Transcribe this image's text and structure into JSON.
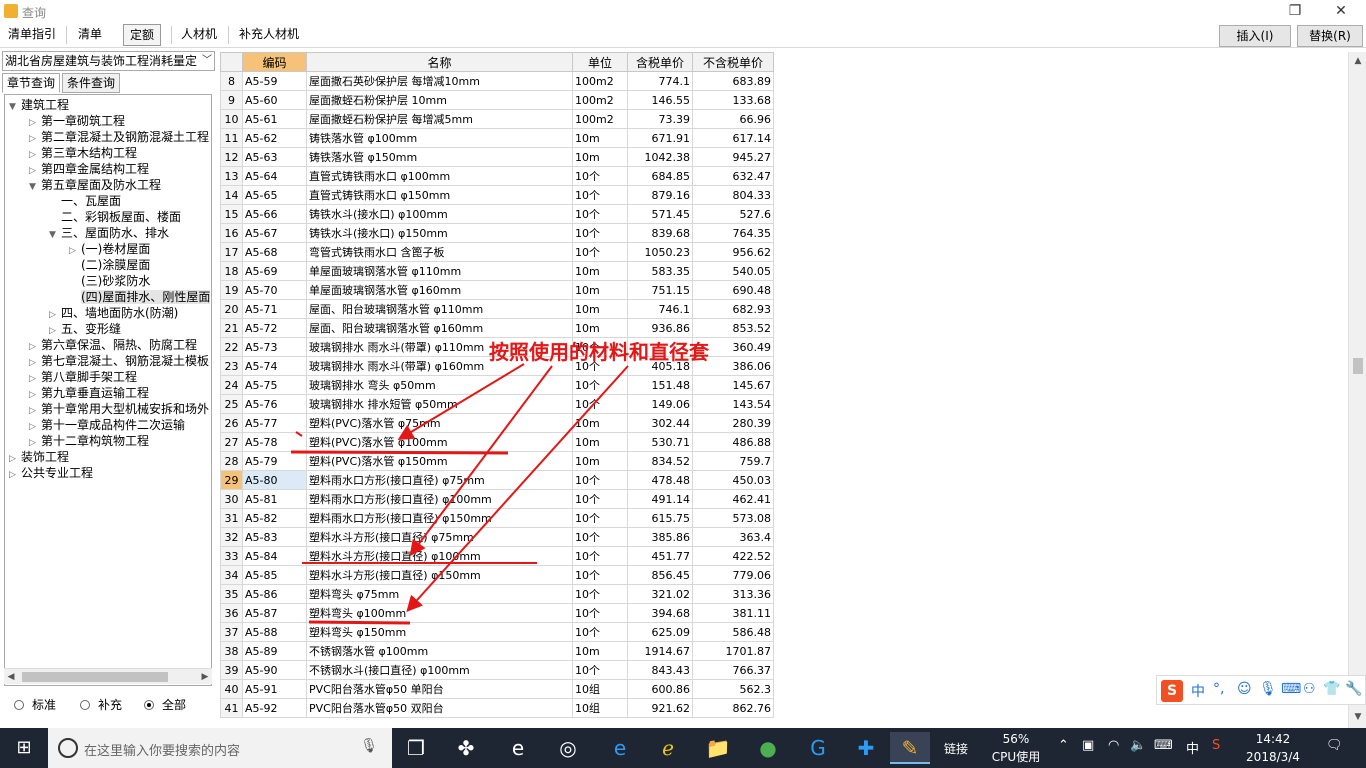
{
  "window": {
    "title": "查询"
  },
  "toolbar": {
    "tabs": [
      "清单指引",
      "清单",
      "定额",
      "人材机",
      "补充人材机"
    ],
    "insert_label": "插入(I)",
    "replace_label": "替换(R)"
  },
  "left": {
    "library": "湖北省房屋建筑与装饰工程消耗量定",
    "query_tabs": [
      "章节查询",
      "条件查询"
    ],
    "tree": [
      {
        "label": "建筑工程",
        "level": 0,
        "arrow": "▼"
      },
      {
        "label": "第一章砌筑工程",
        "level": 1,
        "arrow": "▷"
      },
      {
        "label": "第二章混凝土及钢筋混凝土工程",
        "level": 1,
        "arrow": "▷"
      },
      {
        "label": "第三章木结构工程",
        "level": 1,
        "arrow": "▷"
      },
      {
        "label": "第四章金属结构工程",
        "level": 1,
        "arrow": "▷"
      },
      {
        "label": "第五章屋面及防水工程",
        "level": 1,
        "arrow": "▼"
      },
      {
        "label": "一、瓦屋面",
        "level": 2,
        "arrow": ""
      },
      {
        "label": "二、彩钢板屋面、楼面",
        "level": 2,
        "arrow": ""
      },
      {
        "label": "三、屋面防水、排水",
        "level": 2,
        "arrow": "▼"
      },
      {
        "label": "(一)卷材屋面",
        "level": 3,
        "arrow": "▷"
      },
      {
        "label": "(二)涂膜屋面",
        "level": 3,
        "arrow": ""
      },
      {
        "label": "(三)砂浆防水",
        "level": 3,
        "arrow": ""
      },
      {
        "label": "(四)屋面排水、刚性屋面",
        "level": 3,
        "arrow": "",
        "selected": true
      },
      {
        "label": "四、墙地面防水(防潮)",
        "level": 2,
        "arrow": "▷"
      },
      {
        "label": "五、变形缝",
        "level": 2,
        "arrow": "▷"
      },
      {
        "label": "第六章保温、隔热、防腐工程",
        "level": 1,
        "arrow": "▷"
      },
      {
        "label": "第七章混凝土、钢筋混凝土模板",
        "level": 1,
        "arrow": "▷"
      },
      {
        "label": "第八章脚手架工程",
        "level": 1,
        "arrow": "▷"
      },
      {
        "label": "第九章垂直运输工程",
        "level": 1,
        "arrow": "▷"
      },
      {
        "label": "第十章常用大型机械安拆和场外",
        "level": 1,
        "arrow": "▷"
      },
      {
        "label": "第十一章成品构件二次运输",
        "level": 1,
        "arrow": "▷"
      },
      {
        "label": "第十二章构筑物工程",
        "level": 1,
        "arrow": "▷"
      },
      {
        "label": "装饰工程",
        "level": 0,
        "arrow": "▷"
      },
      {
        "label": "公共专业工程",
        "level": 0,
        "arrow": "▷"
      }
    ],
    "radios": [
      {
        "label": "标准",
        "checked": false
      },
      {
        "label": "补充",
        "checked": false
      },
      {
        "label": "全部",
        "checked": true
      }
    ]
  },
  "grid": {
    "headers": [
      "编码",
      "名称",
      "单位",
      "含税单价",
      "不含税单价"
    ],
    "selected_row": 29,
    "rows": [
      {
        "n": "8",
        "code": "A5-59",
        "name": "屋面撒石英砂保护层 每增减10mm",
        "unit": "100m2",
        "p1": "774.1",
        "p2": "683.89"
      },
      {
        "n": "9",
        "code": "A5-60",
        "name": "屋面撒蛭石粉保护层 10mm",
        "unit": "100m2",
        "p1": "146.55",
        "p2": "133.68"
      },
      {
        "n": "10",
        "code": "A5-61",
        "name": "屋面撒蛭石粉保护层 每增减5mm",
        "unit": "100m2",
        "p1": "73.39",
        "p2": "66.96"
      },
      {
        "n": "11",
        "code": "A5-62",
        "name": "铸铁落水管 φ100mm",
        "unit": "10m",
        "p1": "671.91",
        "p2": "617.14"
      },
      {
        "n": "12",
        "code": "A5-63",
        "name": "铸铁落水管 φ150mm",
        "unit": "10m",
        "p1": "1042.38",
        "p2": "945.27"
      },
      {
        "n": "13",
        "code": "A5-64",
        "name": "直管式铸铁雨水口 φ100mm",
        "unit": "10个",
        "p1": "684.85",
        "p2": "632.47"
      },
      {
        "n": "14",
        "code": "A5-65",
        "name": "直管式铸铁雨水口 φ150mm",
        "unit": "10个",
        "p1": "879.16",
        "p2": "804.33"
      },
      {
        "n": "15",
        "code": "A5-66",
        "name": "铸铁水斗(接水口) φ100mm",
        "unit": "10个",
        "p1": "571.45",
        "p2": "527.6"
      },
      {
        "n": "16",
        "code": "A5-67",
        "name": "铸铁水斗(接水口) φ150mm",
        "unit": "10个",
        "p1": "839.68",
        "p2": "764.35"
      },
      {
        "n": "17",
        "code": "A5-68",
        "name": "弯管式铸铁雨水口 含篦子板",
        "unit": "10个",
        "p1": "1050.23",
        "p2": "956.62"
      },
      {
        "n": "18",
        "code": "A5-69",
        "name": "单屋面玻璃钢落水管 φ110mm",
        "unit": "10m",
        "p1": "583.35",
        "p2": "540.05"
      },
      {
        "n": "19",
        "code": "A5-70",
        "name": "单屋面玻璃钢落水管 φ160mm",
        "unit": "10m",
        "p1": "751.15",
        "p2": "690.48"
      },
      {
        "n": "20",
        "code": "A5-71",
        "name": "屋面、阳台玻璃钢落水管 φ110mm",
        "unit": "10m",
        "p1": "746.1",
        "p2": "682.93"
      },
      {
        "n": "21",
        "code": "A5-72",
        "name": "屋面、阳台玻璃钢落水管 φ160mm",
        "unit": "10m",
        "p1": "936.86",
        "p2": "853.52"
      },
      {
        "n": "22",
        "code": "A5-73",
        "name": "玻璃钢排水 雨水斗(带罩) φ110mm",
        "unit": "10个",
        "p1": "",
        "p2": "360.49"
      },
      {
        "n": "23",
        "code": "A5-74",
        "name": "玻璃钢排水 雨水斗(带罩) φ160mm",
        "unit": "10个",
        "p1": "405.18",
        "p2": "386.06"
      },
      {
        "n": "24",
        "code": "A5-75",
        "name": "玻璃钢排水 弯头 φ50mm",
        "unit": "10个",
        "p1": "151.48",
        "p2": "145.67"
      },
      {
        "n": "25",
        "code": "A5-76",
        "name": "玻璃钢排水 排水短管 φ50mm",
        "unit": "10个",
        "p1": "149.06",
        "p2": "143.54"
      },
      {
        "n": "26",
        "code": "A5-77",
        "name": "塑料(PVC)落水管 φ75mm",
        "unit": "10m",
        "p1": "302.44",
        "p2": "280.39"
      },
      {
        "n": "27",
        "code": "A5-78",
        "name": "塑料(PVC)落水管 φ100mm",
        "unit": "10m",
        "p1": "530.71",
        "p2": "486.88"
      },
      {
        "n": "28",
        "code": "A5-79",
        "name": "塑料(PVC)落水管 φ150mm",
        "unit": "10m",
        "p1": "834.52",
        "p2": "759.7"
      },
      {
        "n": "29",
        "code": "A5-80",
        "name": "塑料雨水口方形(接口直径) φ75mm",
        "unit": "10个",
        "p1": "478.48",
        "p2": "450.03"
      },
      {
        "n": "30",
        "code": "A5-81",
        "name": "塑料雨水口方形(接口直径) φ100mm",
        "unit": "10个",
        "p1": "491.14",
        "p2": "462.41"
      },
      {
        "n": "31",
        "code": "A5-82",
        "name": "塑料雨水口方形(接口直径) φ150mm",
        "unit": "10个",
        "p1": "615.75",
        "p2": "573.08"
      },
      {
        "n": "32",
        "code": "A5-83",
        "name": "塑料水斗方形(接口直径) φ75mm",
        "unit": "10个",
        "p1": "385.86",
        "p2": "363.4"
      },
      {
        "n": "33",
        "code": "A5-84",
        "name": "塑料水斗方形(接口直径) φ100mm",
        "unit": "10个",
        "p1": "451.77",
        "p2": "422.52"
      },
      {
        "n": "34",
        "code": "A5-85",
        "name": "塑料水斗方形(接口直径) φ150mm",
        "unit": "10个",
        "p1": "856.45",
        "p2": "779.06"
      },
      {
        "n": "35",
        "code": "A5-86",
        "name": "塑料弯头 φ75mm",
        "unit": "10个",
        "p1": "321.02",
        "p2": "313.36"
      },
      {
        "n": "36",
        "code": "A5-87",
        "name": "塑料弯头 φ100mm",
        "unit": "10个",
        "p1": "394.68",
        "p2": "381.11"
      },
      {
        "n": "37",
        "code": "A5-88",
        "name": "塑料弯头 φ150mm",
        "unit": "10个",
        "p1": "625.09",
        "p2": "586.48"
      },
      {
        "n": "38",
        "code": "A5-89",
        "name": "不锈钢落水管 φ100mm",
        "unit": "10m",
        "p1": "1914.67",
        "p2": "1701.87"
      },
      {
        "n": "39",
        "code": "A5-90",
        "name": "不锈钢水斗(接口直径) φ100mm",
        "unit": "10个",
        "p1": "843.43",
        "p2": "766.37"
      },
      {
        "n": "40",
        "code": "A5-91",
        "name": "PVC阳台落水管φ50 单阳台",
        "unit": "10组",
        "p1": "600.86",
        "p2": "562.3"
      },
      {
        "n": "41",
        "code": "A5-92",
        "name": "PVC阳台落水管φ50 双阳台",
        "unit": "10组",
        "p1": "921.62",
        "p2": "862.76"
      }
    ]
  },
  "annotation": {
    "text": "按照使用的材料和直径套",
    "color": "#e41616"
  },
  "ime": {
    "lang": "中"
  },
  "taskbar": {
    "search_placeholder": "在这里输入你要搜索的内容",
    "link_label": "链接",
    "cpu_percent": "56%",
    "cpu_label": "CPU使用",
    "lang": "中",
    "time": "14:42",
    "date": "2018/3/4"
  }
}
